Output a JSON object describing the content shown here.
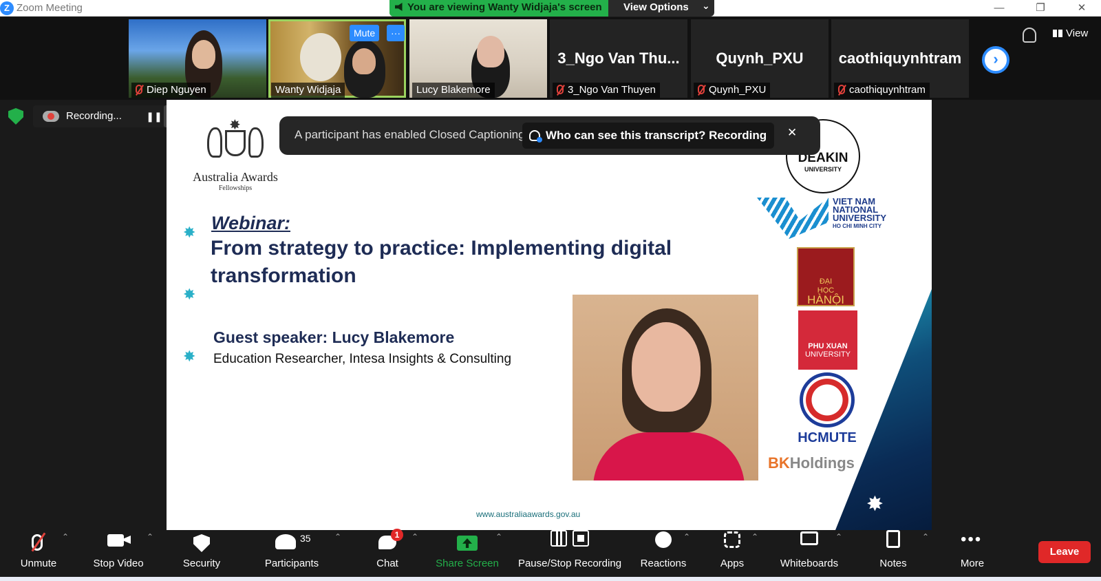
{
  "window": {
    "title": "Zoom Meeting",
    "minimize": "—",
    "restore": "❐",
    "close": "✕"
  },
  "view_banner": {
    "text": "You are viewing Wanty Widjaja's screen",
    "options_label": "View Options",
    "options_caret": "⌄"
  },
  "participants_strip": [
    {
      "name": "Diep Nguyen",
      "muted": true,
      "video": true
    },
    {
      "name": "Wanty Widjaja",
      "muted": false,
      "video": true,
      "active": true,
      "mute_button": "Mute",
      "more_button": "···"
    },
    {
      "name": "Lucy Blakemore",
      "muted": false,
      "video": true
    },
    {
      "name": "3_Ngo Van Thuyen",
      "display": "3_Ngo Van Thu...",
      "muted": true,
      "video": false
    },
    {
      "name": "Quynh_PXU",
      "display": "Quynh_PXU",
      "muted": true,
      "video": false
    },
    {
      "name": "caothiquynhtram",
      "display": "caothiquynhtram",
      "muted": true,
      "video": false
    }
  ],
  "strip_next": "›",
  "side": {
    "view_label": "View"
  },
  "recording": {
    "label": "Recording...",
    "pause_label": "❚❚"
  },
  "slide": {
    "org_title": "Australia Awards",
    "org_sub": "Fellowships",
    "cc_notice": "A participant has enabled Closed Captioning",
    "cc_button": "Who can see this transcript? Recording on",
    "cc_close": "✕",
    "webinar": "Webinar:",
    "title": "From strategy to practice: Implementing digital transformation",
    "guest": "Guest speaker: Lucy Blakemore",
    "role": "Education Researcher, Intesa Insights & Consulting",
    "url": "www.australiaawards.gov.au",
    "bullet": "✸",
    "corner_star": "✸",
    "logos": {
      "deakin": "DEAKIN",
      "deakin_sub": "UNIVERSITY",
      "vnu": [
        "VIET NAM",
        "NATIONAL",
        "UNIVERSITY"
      ],
      "vnu_sub": "HO CHI MINH CITY",
      "hanoi_small": "ĐẠI",
      "hanoi_mid": "HỌC",
      "hanoi_big": "HÀNỘI",
      "phuxuan": "PHU XUAN",
      "phuxuan_sub": "UNIVERSITY",
      "hcmute": "HCMUTE",
      "bk": "BK",
      "bk_rest": "Holdings"
    }
  },
  "toolbar": [
    {
      "key": "unmute",
      "label": "Unmute"
    },
    {
      "key": "stop_video",
      "label": "Stop Video"
    },
    {
      "key": "security",
      "label": "Security"
    },
    {
      "key": "participants",
      "label": "Participants",
      "count": "35"
    },
    {
      "key": "chat",
      "label": "Chat",
      "badge": "1"
    },
    {
      "key": "share",
      "label": "Share Screen"
    },
    {
      "key": "pause_stop",
      "label": "Pause/Stop Recording"
    },
    {
      "key": "reactions",
      "label": "Reactions"
    },
    {
      "key": "apps",
      "label": "Apps"
    },
    {
      "key": "whiteboards",
      "label": "Whiteboards"
    },
    {
      "key": "notes",
      "label": "Notes"
    },
    {
      "key": "more",
      "label": "More"
    }
  ],
  "caret": "⌃",
  "leave_label": "Leave",
  "colors": {
    "accent": "#2d8cff",
    "green": "#23b04a",
    "leave": "#e02828",
    "slide_navy": "#1e2c55"
  }
}
